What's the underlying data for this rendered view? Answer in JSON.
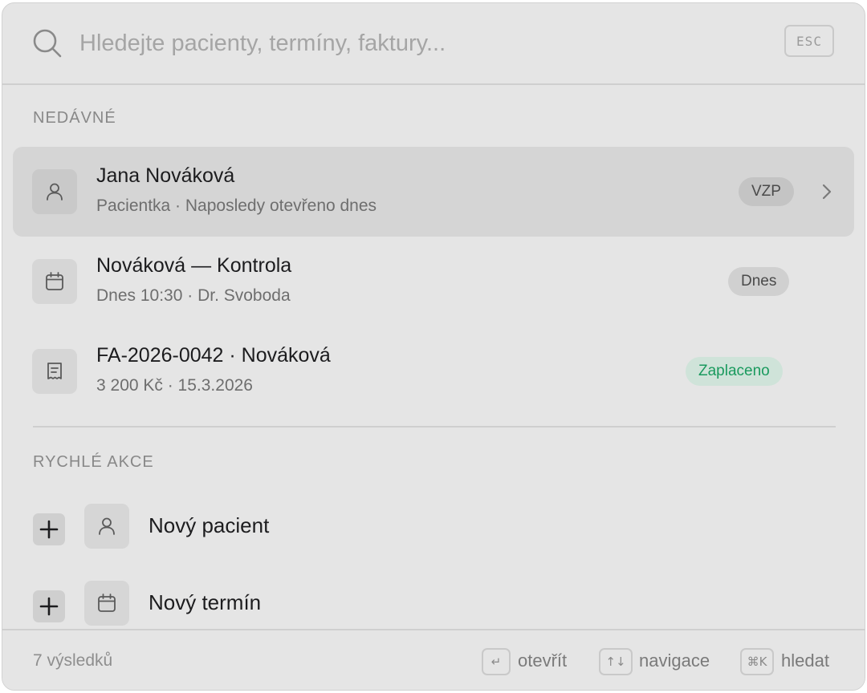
{
  "search": {
    "placeholder": "Hledejte pacienty, termíny, faktury...",
    "value": "",
    "esc_label": "ESC",
    "icon": "search-icon"
  },
  "recent": {
    "label": "NEDÁVNÉ",
    "items": [
      {
        "icon": "user-icon",
        "title": "Jana Nováková",
        "subtitle": "Pacientka · Naposledy otevřeno dnes",
        "badge": "VZP",
        "selected": true
      },
      {
        "icon": "calendar-icon",
        "title": "Nováková — Kontrola",
        "subtitle": "Dnes 10:30 · Dr. Svoboda",
        "badge": "Dnes",
        "selected": false
      },
      {
        "icon": "receipt-icon",
        "title": "FA-2026-0042 · Nováková",
        "subtitle": "3 200 Kč · 15.3.2026",
        "badge": "Zaplaceno",
        "badge_color": "#1a9a5e",
        "selected": false
      }
    ]
  },
  "quick_actions": {
    "label": "RYCHLÉ AKCE",
    "items": [
      {
        "icon": "user-icon",
        "label": "Nový pacient"
      },
      {
        "icon": "calendar-icon",
        "label": "Nový termín"
      }
    ]
  },
  "footer": {
    "result_count": "7 výsledků",
    "hints": [
      {
        "key": "↵",
        "label": "otevřít"
      },
      {
        "key": "↑↓",
        "label": "navigace"
      },
      {
        "key": "⌘K",
        "label": "hledat"
      }
    ]
  },
  "colors": {
    "panel_bg": "#e5e5e5",
    "selected_row_bg": "#d5d5d5",
    "success": "#1a9a5e"
  }
}
